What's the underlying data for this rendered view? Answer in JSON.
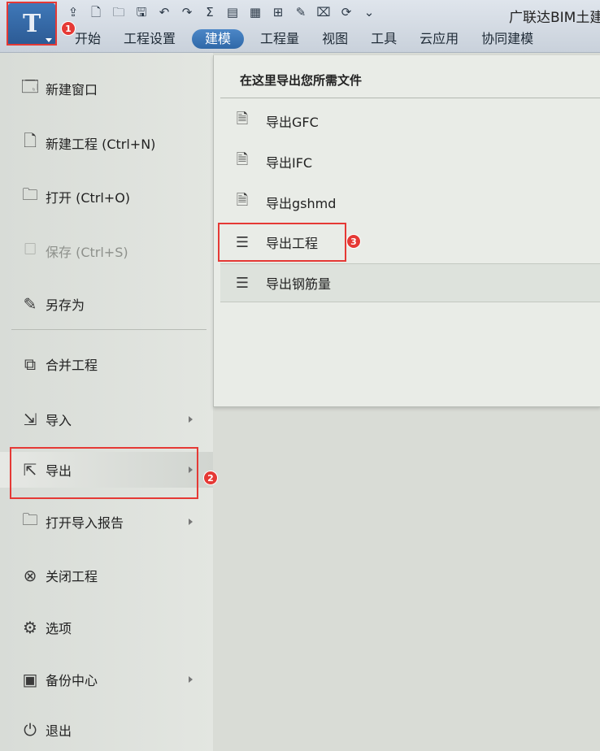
{
  "app": {
    "logo_char": "T",
    "title": "广联达BIM土建",
    "quick_access": [
      {
        "icon": "upload-icon",
        "glyph": "⇪"
      },
      {
        "icon": "new-file-icon",
        "glyph": "🗋"
      },
      {
        "icon": "open-folder-icon",
        "glyph": "🗀"
      },
      {
        "icon": "save-icon",
        "glyph": "🖫"
      },
      {
        "icon": "undo-icon",
        "glyph": "↶"
      },
      {
        "icon": "redo-icon",
        "glyph": "↷"
      },
      {
        "icon": "sum-icon",
        "glyph": "Σ"
      },
      {
        "icon": "report-icon",
        "glyph": "▤"
      },
      {
        "icon": "table-icon",
        "glyph": "▦"
      },
      {
        "icon": "grid-icon",
        "glyph": "⊞"
      },
      {
        "icon": "edit-icon",
        "glyph": "✎"
      },
      {
        "icon": "cut-icon",
        "glyph": "⌧"
      },
      {
        "icon": "refresh-icon",
        "glyph": "⟳"
      },
      {
        "icon": "more-icon",
        "glyph": "⌄"
      }
    ]
  },
  "tabs": [
    {
      "label": "开始",
      "active": false
    },
    {
      "label": "工程设置",
      "active": false
    },
    {
      "label": "建模",
      "active": true
    },
    {
      "label": "工程量",
      "active": false
    },
    {
      "label": "视图",
      "active": false
    },
    {
      "label": "工具",
      "active": false
    },
    {
      "label": "云应用",
      "active": false
    },
    {
      "label": "协同建模",
      "active": false
    }
  ],
  "file_menu": [
    {
      "label": "新建窗口",
      "icon": "new-window-icon",
      "glyph": "🗔",
      "disabled": false,
      "arrow": false
    },
    {
      "label": "新建工程 (Ctrl+N)",
      "icon": "new-project-icon",
      "glyph": "🗋",
      "disabled": false,
      "arrow": false
    },
    {
      "label": "打开 (Ctrl+O)",
      "icon": "open-folder-icon",
      "glyph": "🗀",
      "disabled": false,
      "arrow": false
    },
    {
      "label": "保存 (Ctrl+S)",
      "icon": "save-icon",
      "glyph": "🗆",
      "disabled": true,
      "arrow": false
    },
    {
      "label": "另存为",
      "icon": "save-as-icon",
      "glyph": "✎",
      "disabled": false,
      "arrow": false
    },
    {
      "label": "合并工程",
      "icon": "merge-icon",
      "glyph": "⧉",
      "disabled": false,
      "arrow": false
    },
    {
      "label": "导入",
      "icon": "import-icon",
      "glyph": "⇲",
      "disabled": false,
      "arrow": true
    },
    {
      "label": "导出",
      "icon": "export-icon",
      "glyph": "⇱",
      "disabled": false,
      "arrow": true
    },
    {
      "label": "打开导入报告",
      "icon": "open-report-icon",
      "glyph": "🗀",
      "disabled": false,
      "arrow": true
    },
    {
      "label": "关闭工程",
      "icon": "close-circle-icon",
      "glyph": "⊗",
      "disabled": false,
      "arrow": false
    },
    {
      "label": "选项",
      "icon": "gear-icon",
      "glyph": "⚙",
      "disabled": false,
      "arrow": false
    },
    {
      "label": "备份中心",
      "icon": "backup-icon",
      "glyph": "▣",
      "disabled": false,
      "arrow": true
    },
    {
      "label": "退出",
      "icon": "power-icon",
      "glyph": "⏻",
      "disabled": false,
      "arrow": false
    }
  ],
  "export_submenu": {
    "header": "在这里导出您所需文件",
    "items": [
      {
        "label": "导出GFC",
        "icon": "export-gfc-icon",
        "glyph": "🗎"
      },
      {
        "label": "导出IFC",
        "icon": "export-ifc-icon",
        "glyph": "🗎"
      },
      {
        "label": "导出gshmd",
        "icon": "export-gshmd-icon",
        "glyph": "🗎"
      },
      {
        "label": "导出工程",
        "icon": "export-project-icon",
        "glyph": "☰"
      },
      {
        "label": "导出钢筋量",
        "icon": "export-rebar-icon",
        "glyph": "☰"
      }
    ]
  },
  "annotations": [
    "1",
    "2",
    "3"
  ],
  "colors": {
    "highlight": "#e53935",
    "ribbon_active": "#2f68a8"
  }
}
